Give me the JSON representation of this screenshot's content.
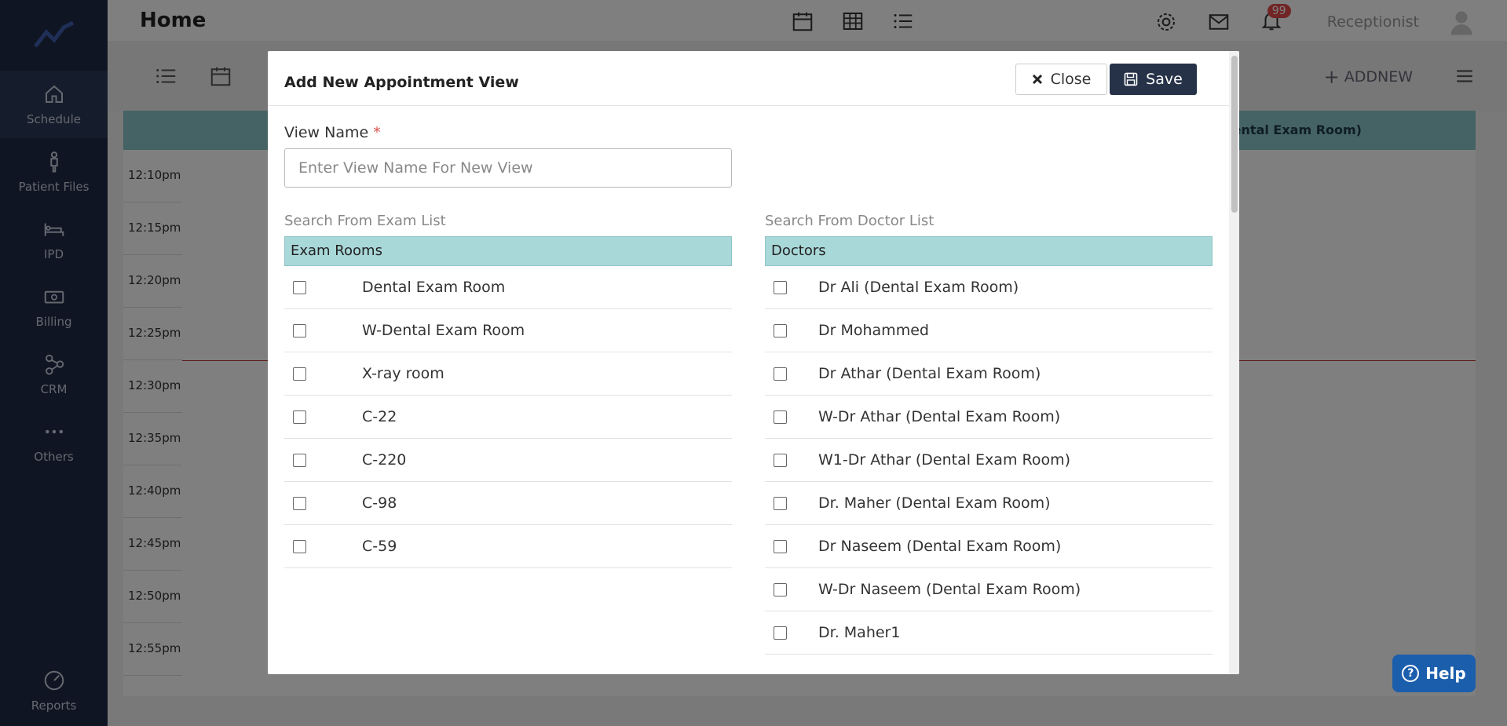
{
  "header": {
    "title": "Home",
    "role": "Receptionist",
    "notifications_count": "99"
  },
  "sidebar": {
    "items": [
      {
        "label": "Schedule",
        "icon": "home-icon"
      },
      {
        "label": "Patient Files",
        "icon": "person-icon"
      },
      {
        "label": "IPD",
        "icon": "bed-icon"
      },
      {
        "label": "Billing",
        "icon": "money-icon"
      },
      {
        "label": "CRM",
        "icon": "network-icon"
      },
      {
        "label": "Others",
        "icon": "dots-icon"
      }
    ],
    "bottom": {
      "label": "Reports",
      "icon": "chart-icon"
    }
  },
  "toolbar": {
    "add_new_label": "ADDNEW"
  },
  "schedule": {
    "header_right": "(Dental Exam Room)",
    "times": [
      "12:10pm",
      "12:15pm",
      "12:20pm",
      "12:25pm",
      "12:30pm",
      "12:35pm",
      "12:40pm",
      "12:45pm",
      "12:50pm",
      "12:55pm"
    ]
  },
  "modal": {
    "title": "Add New Appointment View",
    "close_label": "Close",
    "save_label": "Save",
    "view_name_label": "View Name",
    "view_name_required": "*",
    "view_name_placeholder": "Enter View Name For New View",
    "view_name_value": "",
    "exam": {
      "search_label": "Search From Exam List",
      "header": "Exam Rooms",
      "items": [
        "Dental Exam Room",
        "W-Dental Exam Room",
        "X-ray room",
        "C-22",
        "C-220",
        "C-98",
        "C-59"
      ]
    },
    "doctor": {
      "search_label": "Search From Doctor List",
      "header": "Doctors",
      "items": [
        "Dr Ali (Dental Exam Room)",
        "Dr Mohammed",
        "Dr Athar (Dental Exam Room)",
        "W-Dr Athar (Dental Exam Room)",
        "W1-Dr Athar (Dental Exam Room)",
        "Dr. Maher (Dental Exam Room)",
        "Dr Naseem (Dental Exam Room)",
        "W-Dr Naseem (Dental Exam Room)",
        "Dr. Maher1"
      ]
    }
  },
  "help": {
    "label": "Help"
  },
  "colors": {
    "sidebar": "#1e2a44",
    "accent_teal": "#a9d8d9",
    "save_button": "#263248",
    "help_button": "#1b5eac",
    "badge": "#e24a4a"
  }
}
